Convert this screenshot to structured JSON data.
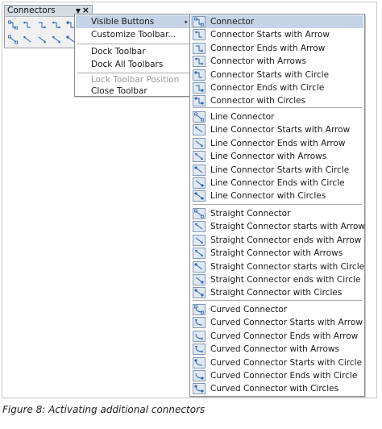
{
  "toolbar": {
    "title": "Connectors",
    "arrow": "▼",
    "close": "×",
    "buttons_row1": [
      "connector-icon",
      "connector-starts-arrow-icon",
      "connector-ends-arrow-icon",
      "connector-arrows-icon",
      "connector-starts-circle-icon",
      "connector-ends-circle-icon"
    ],
    "buttons_row2": [
      "line-connector-icon",
      "line-connector-starts-arrow-icon",
      "line-connector-ends-arrow-icon",
      "line-connector-arrows-icon",
      "line-connector-circle-icon",
      "straight-connector-icon"
    ]
  },
  "context_menu": {
    "items": [
      {
        "label": "Visible Buttons",
        "submenu_arrow": "▸"
      },
      {
        "label": "Customize Toolbar..."
      },
      {
        "label": "Dock Toolbar"
      },
      {
        "label": "Dock All Toolbars"
      },
      {
        "label": "Lock Toolbar Position"
      },
      {
        "label": "Close Toolbar"
      }
    ]
  },
  "visible_buttons": {
    "groups": [
      [
        "Connector",
        "Connector Starts with Arrow",
        "Connector Ends with Arrow",
        "Connector with Arrows",
        "Connector Starts with Circle",
        "Connector Ends with Circle",
        "Connector with Circles"
      ],
      [
        "Line Connector",
        "Line Connector Starts with Arrow",
        "Line Connector Ends with Arrow",
        "Line Connector with Arrows",
        "Line Connector Starts with Circle",
        "Line Connector Ends with Circle",
        "Line Connector with Circles"
      ],
      [
        "Straight Connector",
        "Straight Connector starts with Arrow",
        "Straight Connector ends with Arrow",
        "Straight Connector with Arrows",
        "Straight Connector starts with Circle",
        "Straight Connector ends with Circle",
        "Straight Connector with Circles"
      ],
      [
        "Curved Connector",
        "Curved Connector Starts with Arrow",
        "Curved Connector Ends with Arrow",
        "Curved Connector with Arrows",
        "Curved Connector Starts with Circle",
        "Curved Connector Ends with Circle",
        "Curved Connector with Circles"
      ]
    ]
  },
  "caption": "Figure 8: Activating additional connectors",
  "colors": {
    "highlight": "#c4d3e6",
    "icon_blue": "#2f64a8",
    "disabled_text": "#9a9a9a"
  }
}
